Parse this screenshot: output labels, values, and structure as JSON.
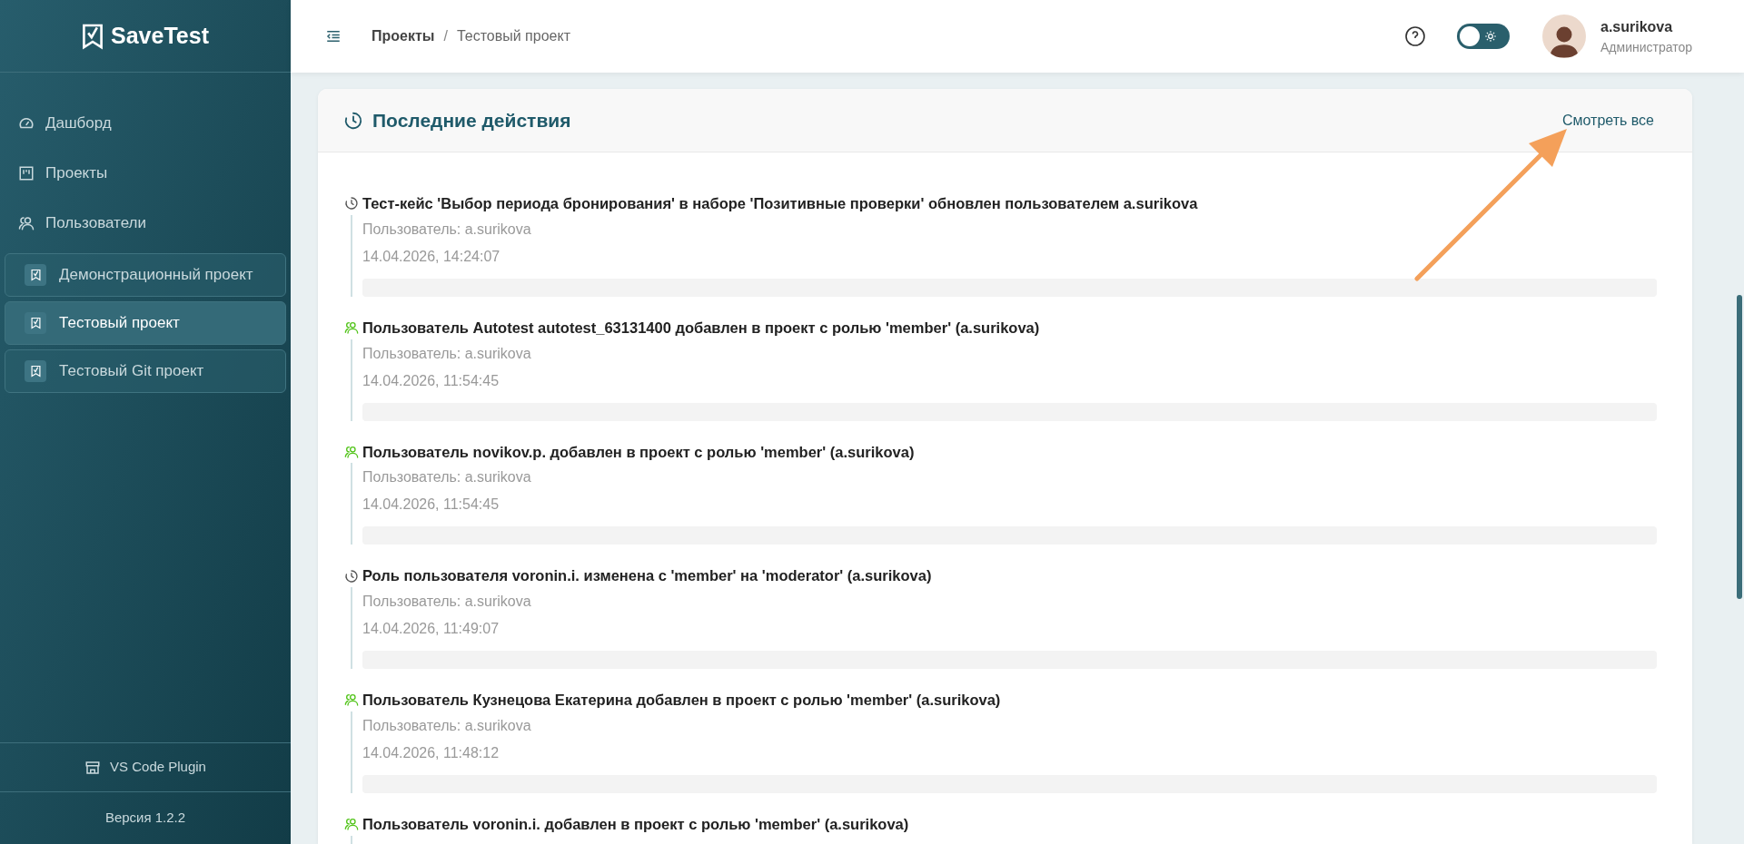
{
  "sidebar": {
    "logo": "SaveTest",
    "nav": [
      {
        "label": "Дашборд",
        "kind": "dashboard"
      },
      {
        "label": "Проекты",
        "kind": "projects"
      },
      {
        "label": "Пользователи",
        "kind": "users"
      }
    ],
    "projects": [
      {
        "label": "Демонстрационный проект",
        "selected": false
      },
      {
        "label": "Тестовый проект",
        "selected": true
      },
      {
        "label": "Тестовый Git проект",
        "selected": false
      }
    ],
    "plugin": "VS Code Plugin",
    "version": "Версия 1.2.2"
  },
  "header": {
    "breadcrumb": [
      "Проекты",
      "Тестовый проект"
    ],
    "separator": "/",
    "dark_mode": false,
    "user": {
      "name": "a.surikova",
      "role": "Администратор"
    }
  },
  "activity": {
    "title": "Последние действия",
    "view_all": "Смотреть все",
    "items": [
      {
        "kind": "update",
        "title": "Тест-кейс 'Выбор периода бронирования' в наборе 'Позитивные проверки' обновлен пользователем a.surikova",
        "user": "Пользователь: a.surikova",
        "date": "14.04.2026, 14:24:07"
      },
      {
        "kind": "user",
        "title": "Пользователь Autotest autotest_63131400 добавлен в проект с ролью 'member' (a.surikova)",
        "user": "Пользователь: a.surikova",
        "date": "14.04.2026, 11:54:45"
      },
      {
        "kind": "user",
        "title": "Пользователь novikov.p. добавлен в проект с ролью 'member' (a.surikova)",
        "user": "Пользователь: a.surikova",
        "date": "14.04.2026, 11:54:45"
      },
      {
        "kind": "update",
        "title": "Роль пользователя voronin.i. изменена с 'member' на 'moderator' (a.surikova)",
        "user": "Пользователь: a.surikova",
        "date": "14.04.2026, 11:49:07"
      },
      {
        "kind": "user",
        "title": "Пользователь Кузнецова Екатерина добавлен в проект с ролью 'member' (a.surikova)",
        "user": "Пользователь: a.surikova",
        "date": "14.04.2026, 11:48:12"
      },
      {
        "kind": "user",
        "title": "Пользователь voronin.i. добавлен в проект с ролью 'member' (a.surikova)"
      }
    ]
  }
}
